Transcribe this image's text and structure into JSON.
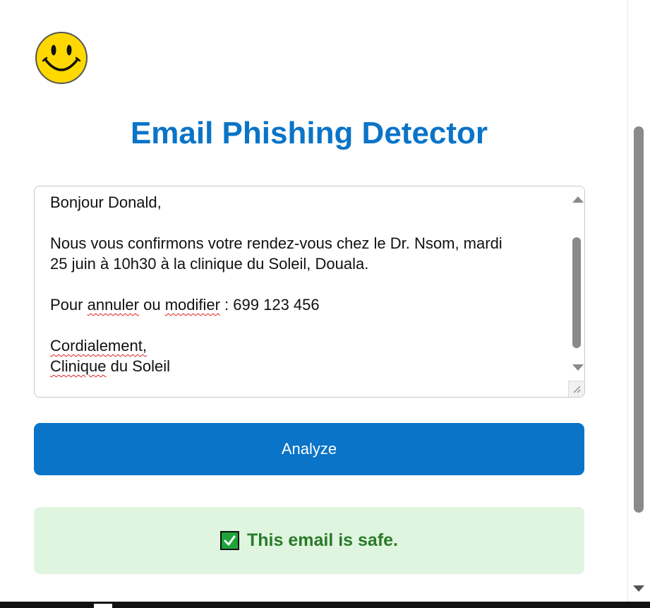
{
  "app": {
    "logo_icon": "smiley-face-icon",
    "title": "Email Phishing Detector"
  },
  "email_input": {
    "greeting": "Bonjour Donald,",
    "body_line1": "Nous vous confirmons votre rendez-vous chez le Dr. Nsom, mardi",
    "body_line2": "25 juin à 10h30 à la clinique du Soleil, Douala.",
    "cancel_prefix": "Pour ",
    "cancel_word1": "annuler",
    "cancel_mid": " ou ",
    "cancel_word2": "modifier",
    "cancel_suffix": " : 699 123 456",
    "closing": "Cordialement,",
    "signature_word": "Clinique",
    "signature_rest": " du Soleil"
  },
  "analyze_button": {
    "label": "Analyze"
  },
  "result": {
    "icon": "check-mark-icon",
    "text": "This email is safe.",
    "status": "safe",
    "color": "#2a7a2a",
    "background": "#dff5df"
  },
  "colors": {
    "accent": "#0a74c8"
  }
}
